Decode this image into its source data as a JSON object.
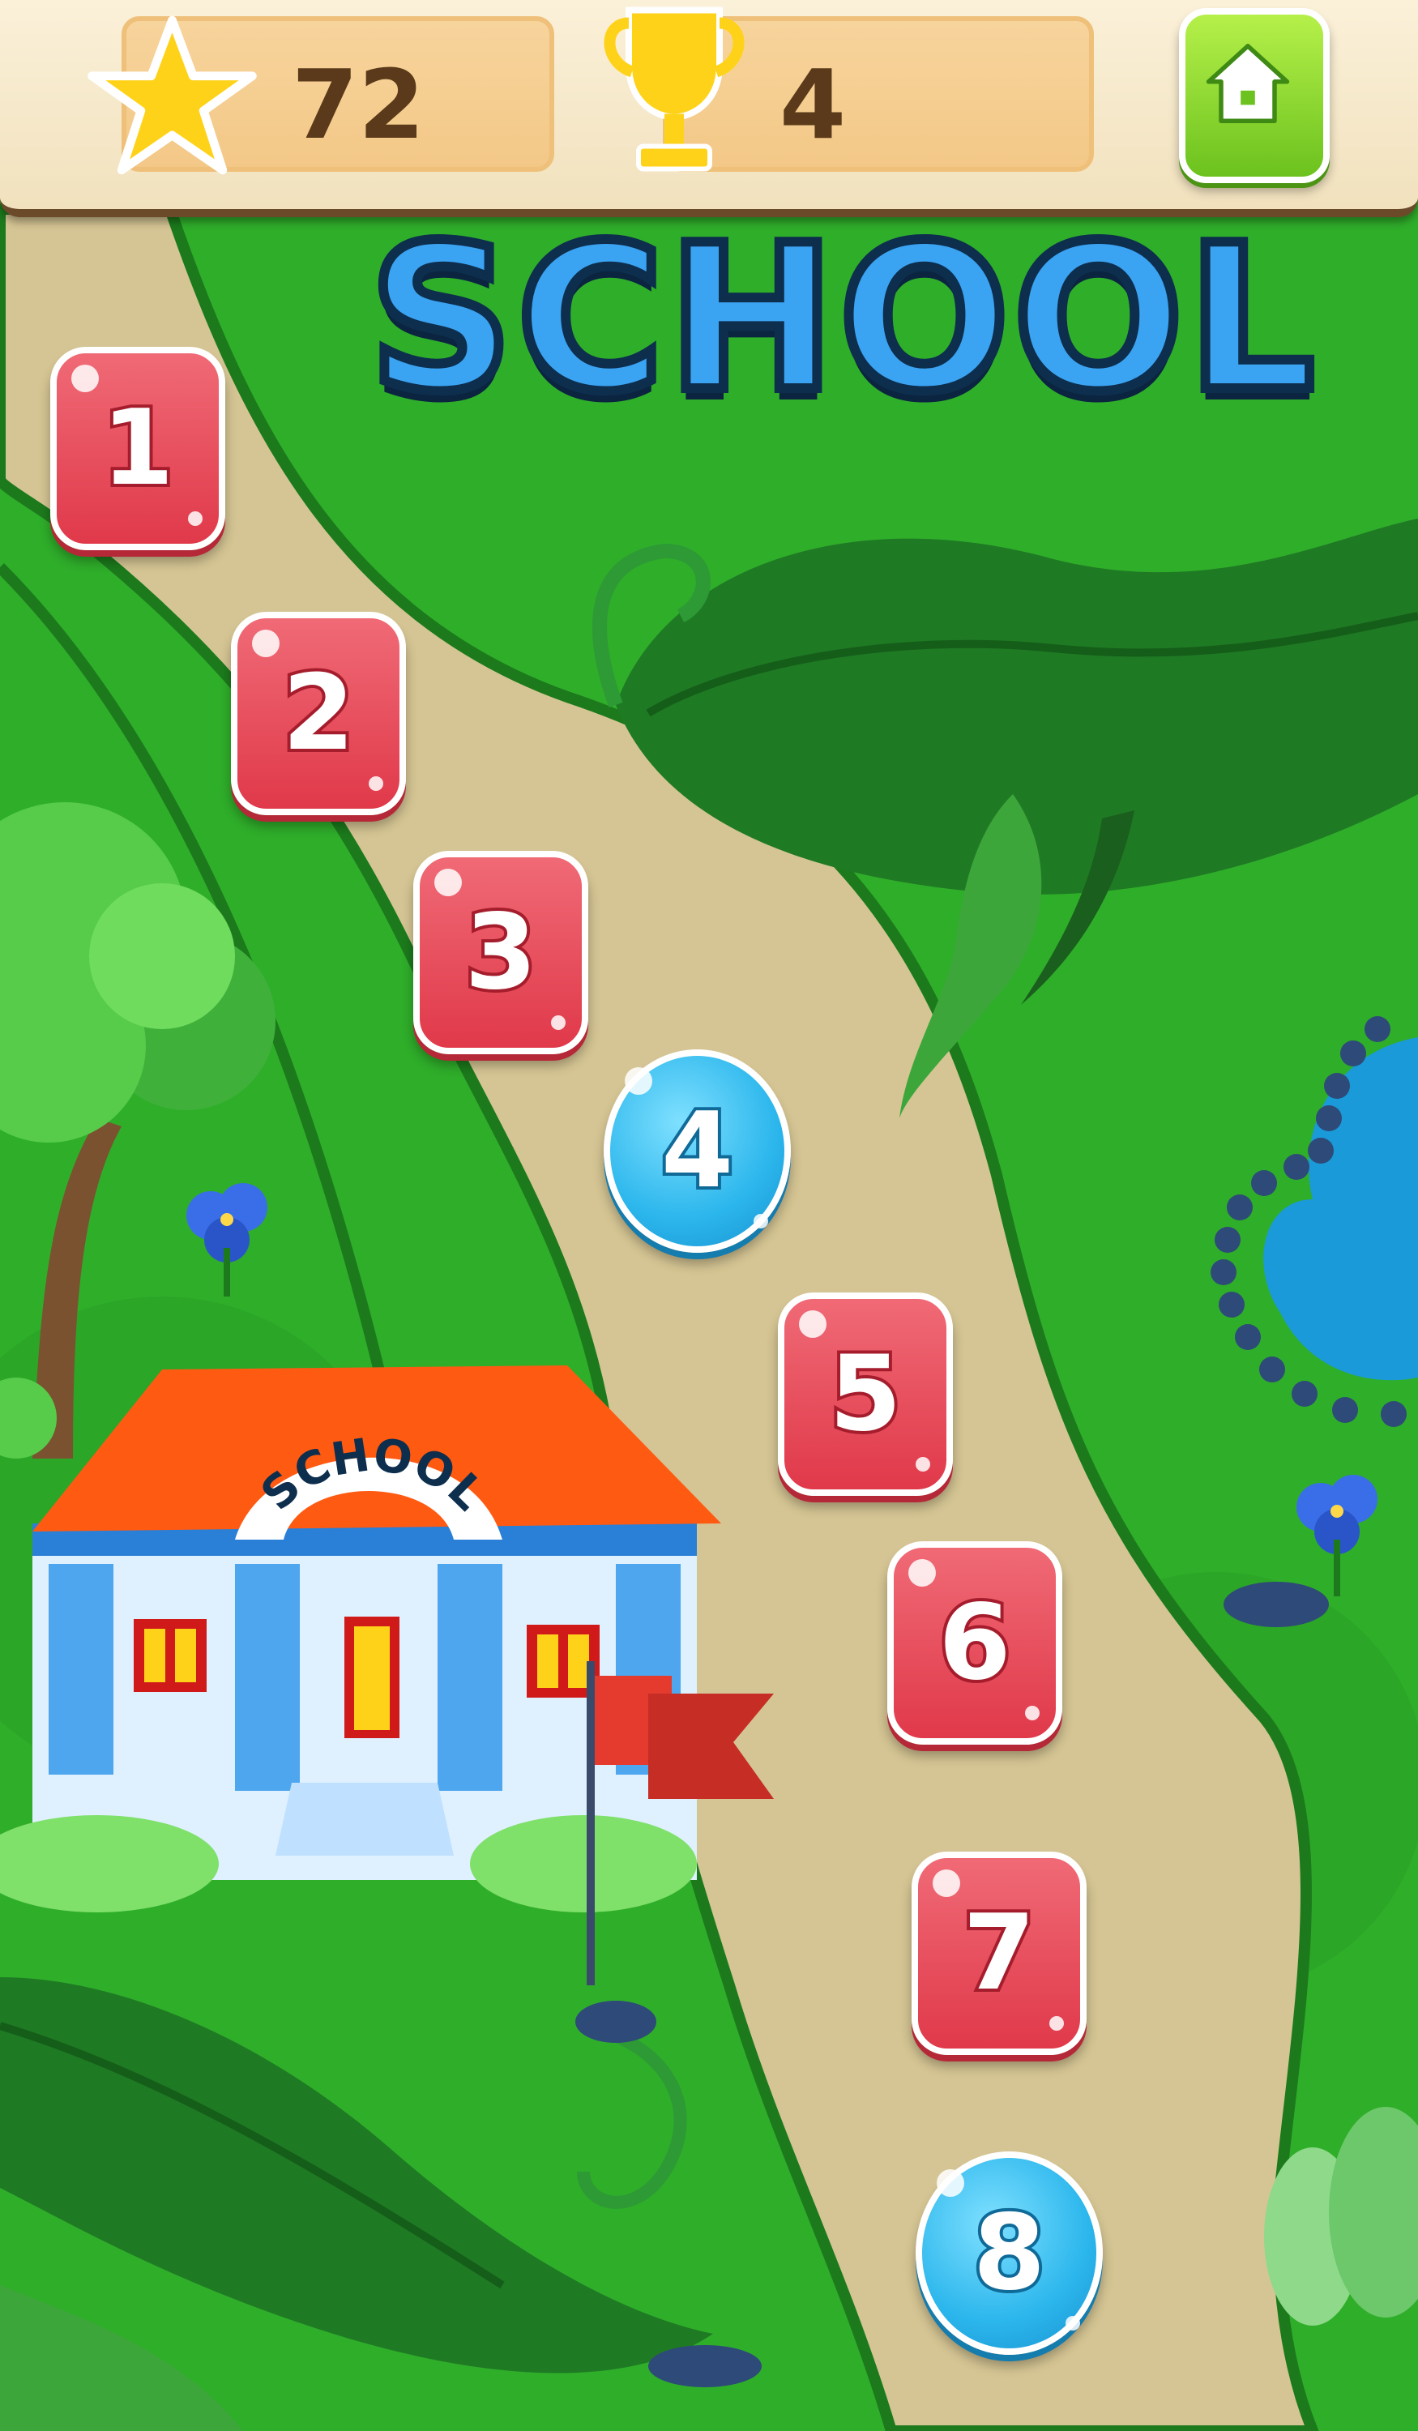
{
  "hud": {
    "stars_count": "72",
    "trophies_count": "4"
  },
  "title": "SCHOOL",
  "building_sign": "SCHOOL",
  "levels": [
    {
      "label": "1",
      "state": "completed"
    },
    {
      "label": "2",
      "state": "completed"
    },
    {
      "label": "3",
      "state": "completed"
    },
    {
      "label": "4",
      "state": "current"
    },
    {
      "label": "5",
      "state": "completed"
    },
    {
      "label": "6",
      "state": "completed"
    },
    {
      "label": "7",
      "state": "completed"
    },
    {
      "label": "8",
      "state": "current"
    }
  ],
  "colors": {
    "grass": "#2fae2a",
    "path": "#d5c594",
    "completed_level": "#e0394a",
    "current_level": "#2bb6ec",
    "title": "#3aa3f2",
    "home_button": "#6cc21e"
  },
  "icons": [
    "star-icon",
    "trophy-icon",
    "home-icon"
  ]
}
